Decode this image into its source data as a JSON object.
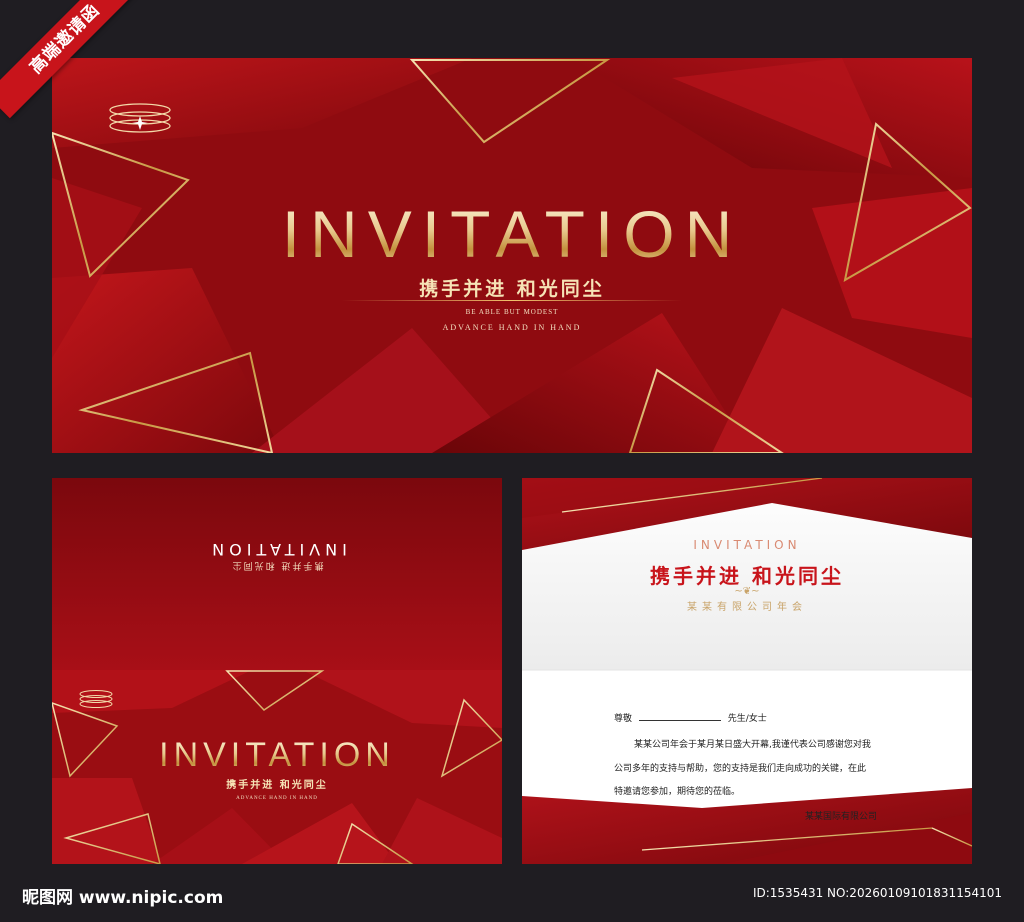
{
  "ribbon": {
    "label": "高端邀请函"
  },
  "cover": {
    "title": "INVITATION",
    "slogan": "携手并进  和光同尘",
    "sub1": "BE ABLE BUT MODEST",
    "sub2": "ADVANCE HAND IN HAND"
  },
  "inside": {
    "mirrored_title": "INVITATION",
    "mirrored_slogan": "携手并进  和光同尘",
    "mini_title": "INVITATION",
    "mini_slogan": "携手并进  和光同尘",
    "mini_sub": "ADVANCE HAND IN HAND"
  },
  "letter": {
    "eyebrow": "INVITATION",
    "heading": "携手并进  和光同尘",
    "org": "某某有限公司年会",
    "salutation": "尊敬",
    "title_suffix": "先生/女士",
    "line1": "某某公司年会于某月某日盛大开幕,我谨代表公司感谢您对我",
    "line2": "公司多年的支持与帮助，您的支持是我们走向成功的关键，在此",
    "line3": "特邀请您参加，期待您的莅临。",
    "signature": "某某国际有限公司"
  },
  "footer": {
    "site": "昵图网 www.nipic.com",
    "id": "ID:1535431 NO:20260109101831154101"
  },
  "colors": {
    "red": "#9a0d12",
    "dark_red": "#6e070b",
    "gold": "#d9b46a",
    "bg": "#1f1d22"
  }
}
